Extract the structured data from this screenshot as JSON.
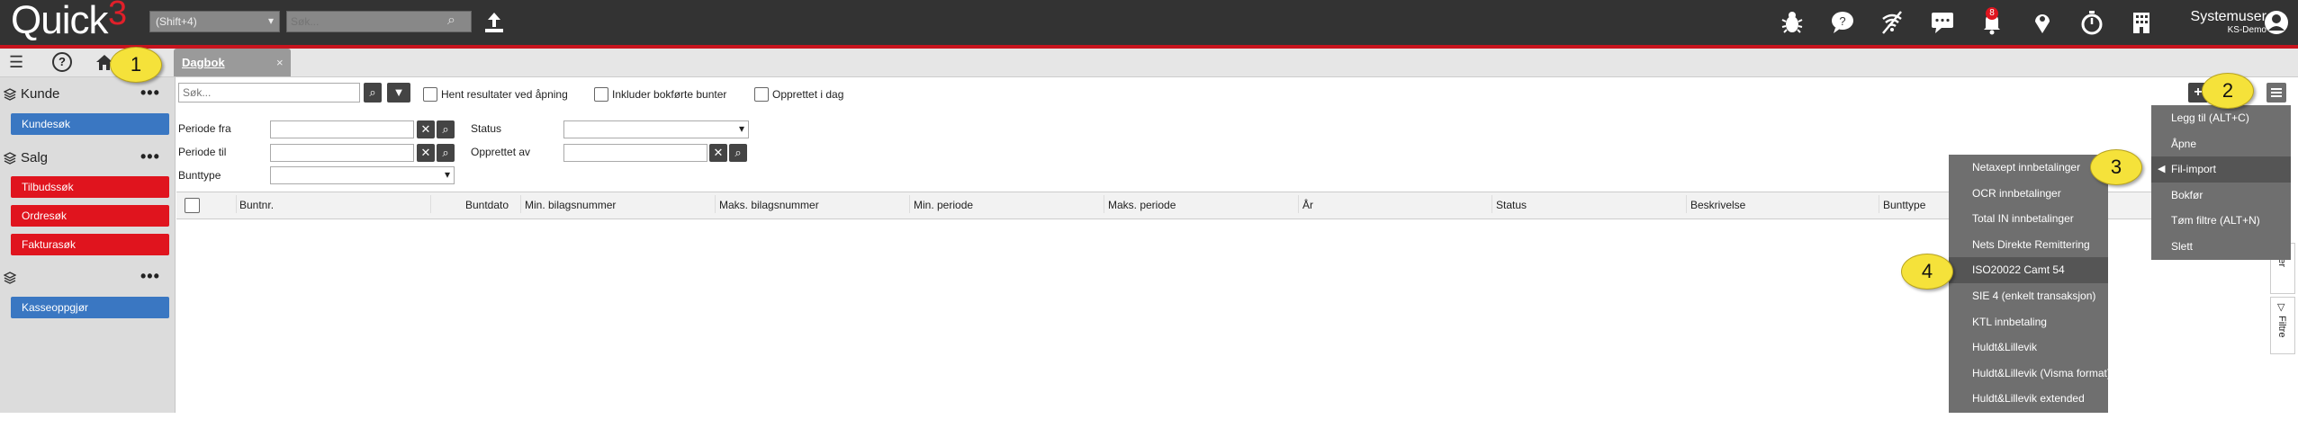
{
  "app": {
    "logo": "Quick",
    "logo_sup": "3"
  },
  "topbar": {
    "shortcut_select": "(Shift+4)",
    "search_placeholder": "Søk...",
    "notification_count": "8",
    "user_name": "Systemuser",
    "company": "KS-Demo"
  },
  "tab": {
    "label": "Dagbok",
    "close": "×"
  },
  "sidebar": {
    "groups": [
      {
        "title": "Kunde",
        "items": [
          "Kundesøk"
        ]
      },
      {
        "title": "Salg",
        "items": [
          "Tilbudssøk",
          "Ordresøk",
          "Fakturasøk"
        ]
      },
      {
        "title": "",
        "items": [
          "Kasseoppgjør"
        ]
      }
    ],
    "dots": "•••"
  },
  "search": {
    "placeholder": "Søk...",
    "options": [
      "Hent resultater ved åpning",
      "Inkluder bokførte bunter",
      "Opprettet i dag"
    ]
  },
  "filters": {
    "periode_fra": "Periode fra",
    "periode_til": "Periode til",
    "bunttype": "Bunttype",
    "status": "Status",
    "opprettet_av": "Opprettet av"
  },
  "table": {
    "columns": [
      "Buntnr.",
      "Buntdato",
      "Min. bilagsnummer",
      "Maks. bilagsnummer",
      "Min. periode",
      "Maks. periode",
      "År",
      "Status",
      "Beskrivelse",
      "Bunttype"
    ]
  },
  "main_menu": {
    "items": [
      "Legg til (ALT+C)",
      "Åpne",
      "Fil-import",
      "Bokfør",
      "Tøm filtre (ALT+N)",
      "Slett"
    ]
  },
  "import_menu": {
    "items": [
      "Netaxept innbetalinger",
      "OCR innbetalinger",
      "Total IN innbetalinger",
      "Nets Direkte Remittering",
      "ISO20022 Camt 54",
      "SIE 4 (enkelt transaksjon)",
      "KTL innbetaling",
      "Huldt&Lillevik",
      "Huldt&Lillevik (Visma format)",
      "Huldt&Lillevik extended standard"
    ]
  },
  "side_tabs": {
    "kolonner": "nner",
    "filtre": "Filtre"
  },
  "callouts": [
    "1",
    "2",
    "3",
    "4"
  ],
  "icons": [
    "bug-icon",
    "chat-bubble-icon",
    "no-signal-icon",
    "message-icon",
    "bell-icon",
    "location-icon",
    "stopwatch-icon",
    "building-icon",
    "user-circle-icon"
  ],
  "colors": {
    "accent_red": "#c8141e",
    "sidebar_blue": "#3a77c2",
    "sidebar_red": "#e0141e",
    "menu_bg": "#6f6f6f",
    "callout": "#f5e23a"
  }
}
